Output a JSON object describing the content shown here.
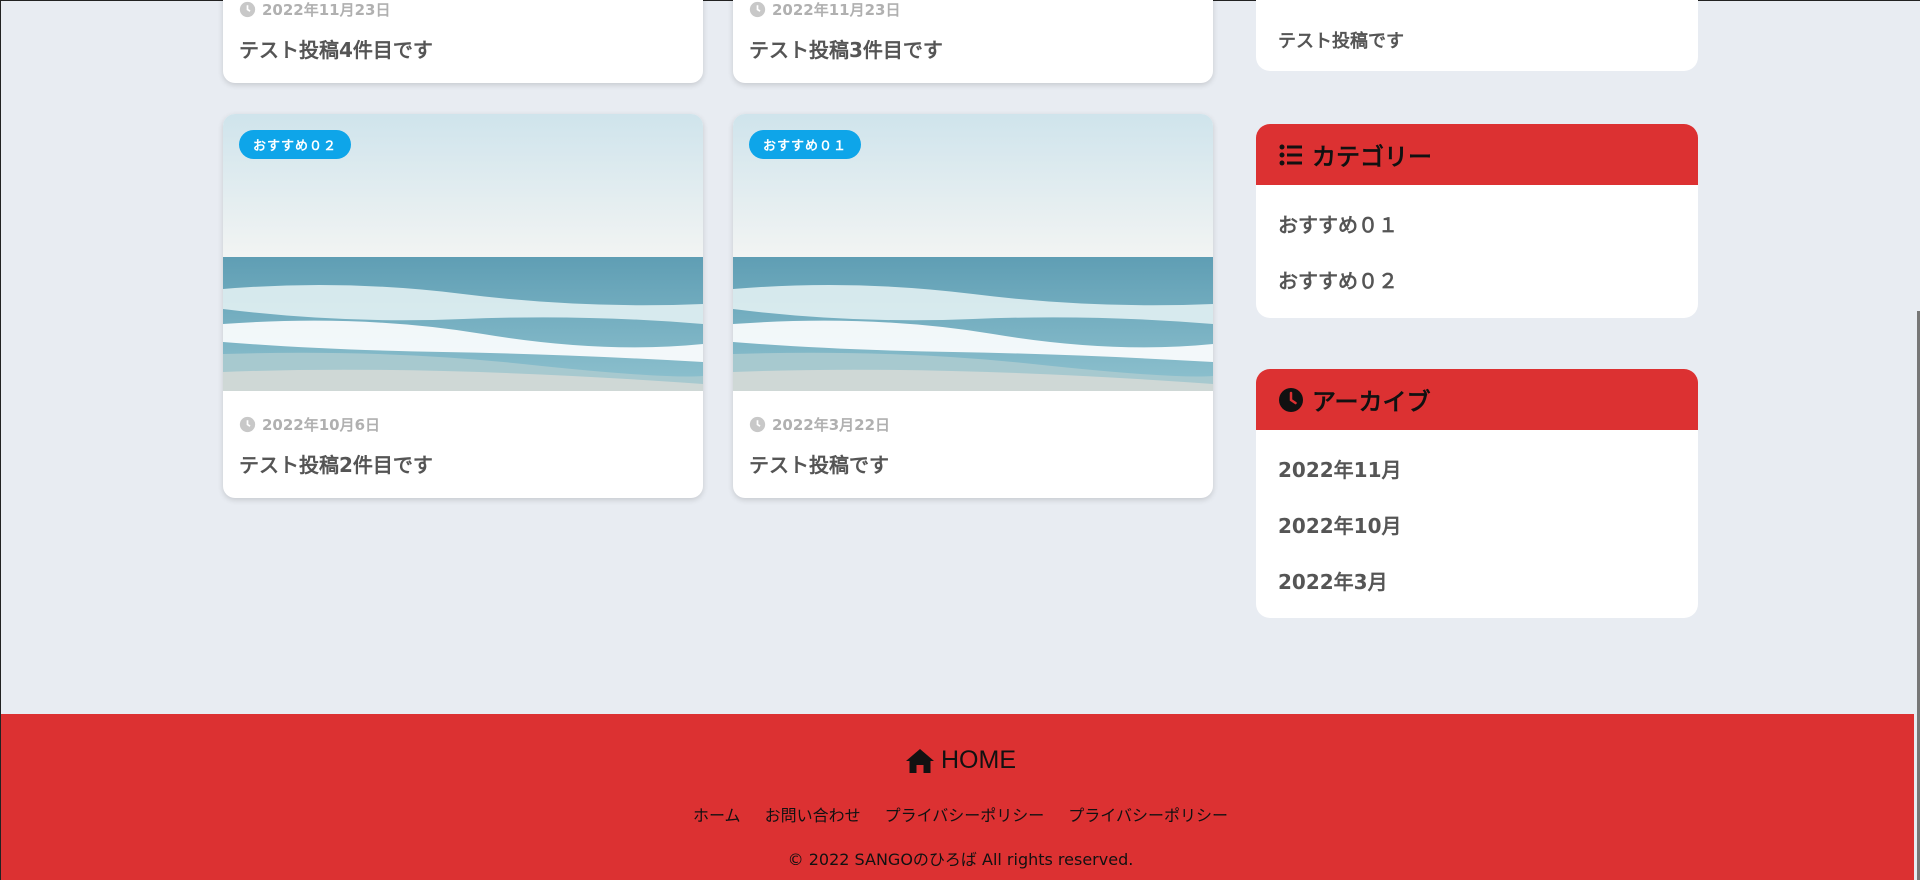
{
  "posts": [
    {
      "date": "2022年11月23日",
      "title": "テスト投稿4件目です"
    },
    {
      "date": "2022年11月23日",
      "title": "テスト投稿3件目です"
    },
    {
      "badge": "おすすめ０２",
      "date": "2022年10月6日",
      "title": "テスト投稿2件目です"
    },
    {
      "badge": "おすすめ０１",
      "date": "2022年3月22日",
      "title": "テスト投稿です"
    }
  ],
  "sidebar": {
    "recent_last": "テスト投稿です",
    "categories": {
      "heading": "カテゴリー",
      "items": [
        "おすすめ０１",
        "おすすめ０２"
      ]
    },
    "archives": {
      "heading": "アーカイブ",
      "items": [
        "2022年11月",
        "2022年10月",
        "2022年3月"
      ]
    }
  },
  "footer": {
    "home": "HOME",
    "nav": [
      "ホーム",
      "お問い合わせ",
      "プライバシーポリシー",
      "プライバシーポリシー"
    ],
    "copyright": "© 2022 SANGOのひろば All rights reserved."
  },
  "colors": {
    "accent": "#dc3132",
    "badge": "#0ea5e9",
    "background": "#e8ecf2"
  }
}
